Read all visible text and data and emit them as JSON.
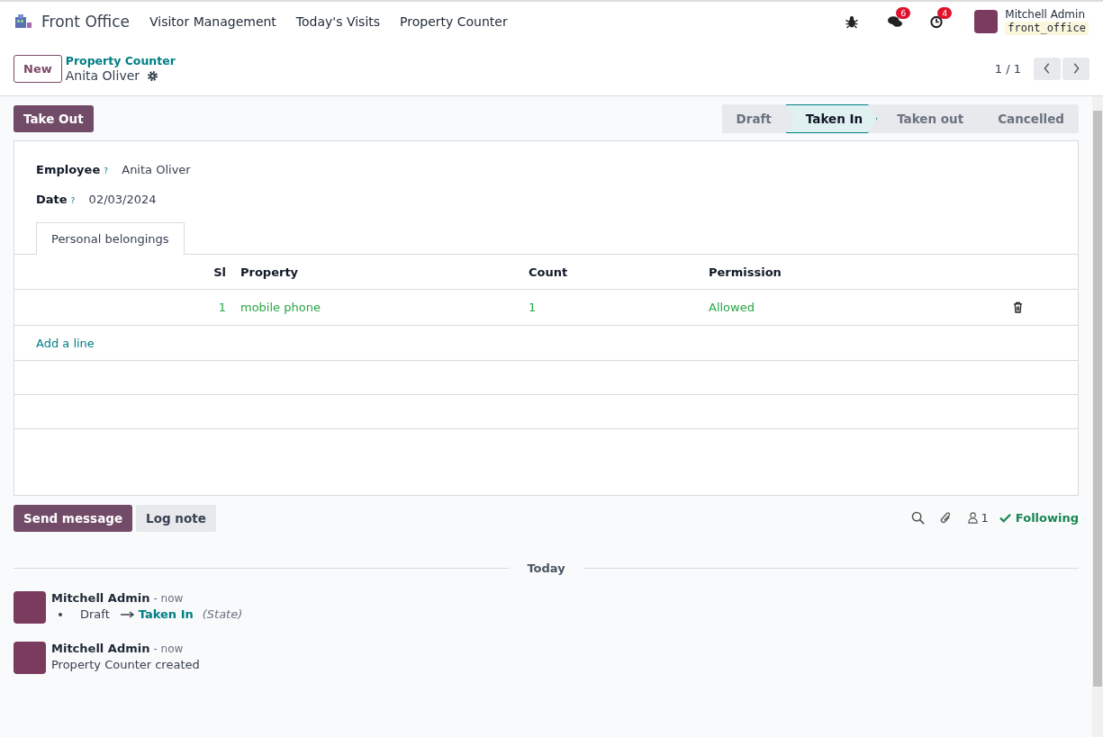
{
  "navbar": {
    "app_name": "Front Office",
    "menu": [
      "Visitor Management",
      "Today's Visits",
      "Property Counter"
    ],
    "messages_count": "6",
    "activities_count": "4",
    "user": {
      "name": "Mitchell Admin",
      "database": "front_office"
    }
  },
  "control_panel": {
    "new_button": "New",
    "breadcrumb": "Property Counter",
    "record_name": "Anita Oliver",
    "pager": "1 / 1"
  },
  "action_button": "Take Out",
  "stages": [
    {
      "label": "Draft",
      "selected": false
    },
    {
      "label": "Taken In",
      "selected": true
    },
    {
      "label": "Taken out",
      "selected": false
    },
    {
      "label": "Cancelled",
      "selected": false
    }
  ],
  "fields": [
    {
      "label": "Employee",
      "help": "?",
      "value": "Anita Oliver"
    },
    {
      "label": "Date",
      "help": "?",
      "value": "02/03/2024"
    }
  ],
  "notebook_tabs": [
    {
      "label": "Personal belongings",
      "selected": true
    }
  ],
  "table": {
    "columns": [
      "Sl",
      "Property",
      "Count",
      "Permission"
    ],
    "rows": [
      {
        "cells": [
          "1",
          "mobile phone",
          "1",
          "Allowed"
        ]
      }
    ],
    "add_line": "Add a line"
  },
  "chatter": {
    "send_message": "Send message",
    "log_note": "Log note",
    "followers_count": "1",
    "following": "Following",
    "date_separator": "Today",
    "messages": [
      {
        "author": "Mitchell Admin",
        "time": "- now",
        "kind": "tracking",
        "old_value": "Draft",
        "new_value": "Taken In",
        "field": "(State)"
      },
      {
        "author": "Mitchell Admin",
        "time": "- now",
        "kind": "text",
        "body": "Property Counter created"
      }
    ]
  }
}
